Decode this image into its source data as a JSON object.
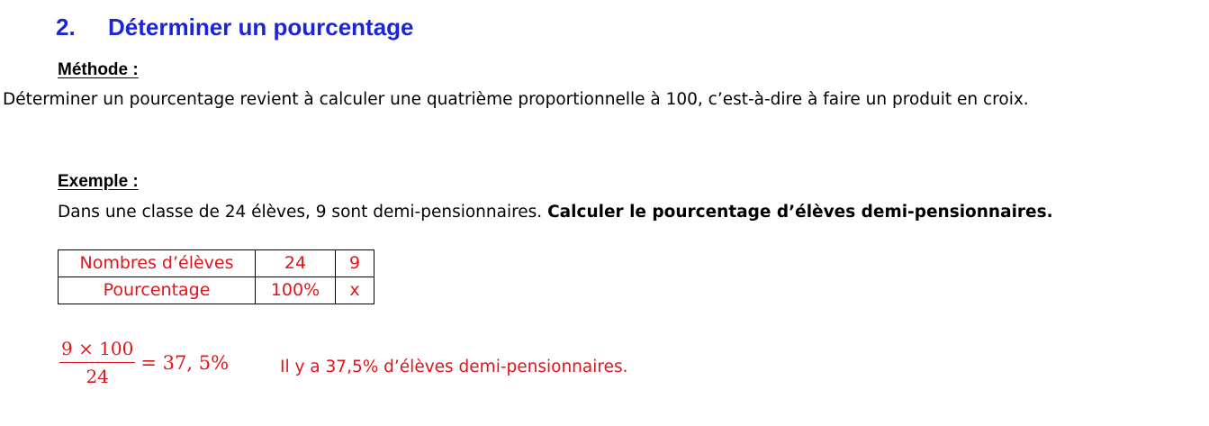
{
  "section": {
    "number": "2.",
    "title": "Déterminer un pourcentage"
  },
  "methode": {
    "label": "Méthode :",
    "text": "Déterminer un pourcentage revient à calculer une quatrième proportionnelle à 100, c’est-à-dire à faire un produit en croix."
  },
  "exemple": {
    "label": "Exemple :",
    "statement": "Dans une classe de 24 élèves, 9 sont demi-pensionnaires. ",
    "question": "Calculer le pourcentage d’élèves demi-pensionnaires."
  },
  "table": {
    "rows": [
      [
        "Nombres d’élèves",
        "24",
        "9"
      ],
      [
        "Pourcentage",
        "100%",
        "x"
      ]
    ]
  },
  "calculation": {
    "numerator": "9 × 100",
    "denominator": "24",
    "result": "= 37, 5%",
    "conclusion": "Il y a 37,5% d’élèves demi-pensionnaires."
  },
  "colors": {
    "heading": "#1c24d8",
    "answer": "#e0141b",
    "text": "#000000"
  }
}
